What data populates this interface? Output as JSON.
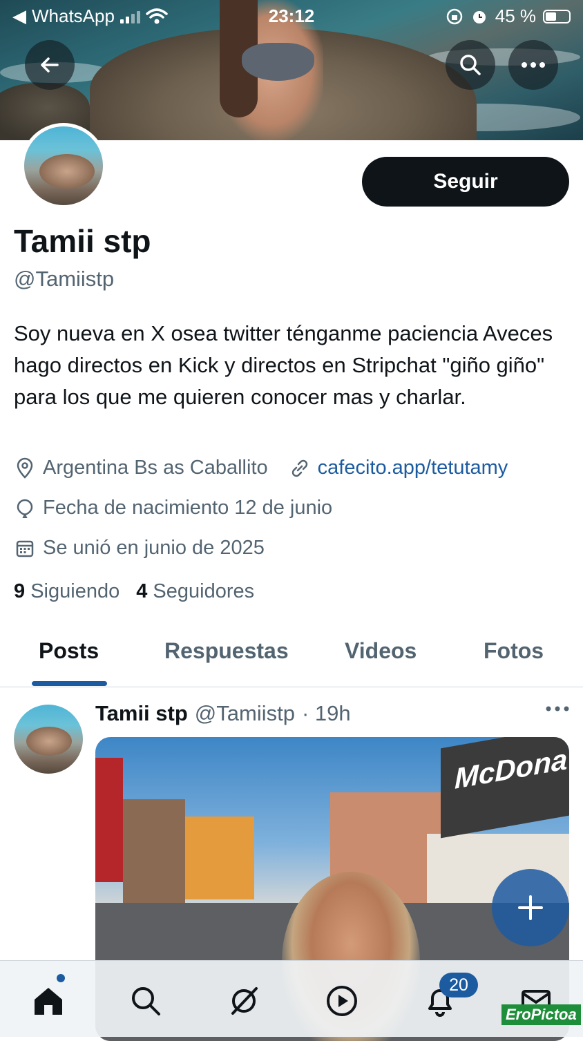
{
  "status_bar": {
    "back_app": "WhatsApp",
    "time": "23:12",
    "battery": "45 %"
  },
  "profile": {
    "follow_label": "Seguir",
    "name": "Tamii stp",
    "handle": "@Tamiistp",
    "bio": "Soy nueva en X osea twitter ténganme paciencia Aveces hago directos en Kick y directos en Stripchat \"giño giño\" para los que me quieren conocer mas y charlar.",
    "location": "Argentina Bs as Caballito",
    "website": "cafecito.app/tetutamy",
    "birthday": "Fecha de nacimiento 12 de junio",
    "joined": "Se unió en junio de 2025",
    "following_count": "9",
    "following_label": "Siguiendo",
    "followers_count": "4",
    "followers_label": "Seguidores"
  },
  "tabs": [
    {
      "label": "Posts",
      "active": true
    },
    {
      "label": "Respuestas",
      "active": false
    },
    {
      "label": "Videos",
      "active": false
    },
    {
      "label": "Fotos",
      "active": false
    }
  ],
  "post": {
    "author": "Tamii stp",
    "handle": "@Tamiistp",
    "time": "· 19h",
    "image_sign_text": "McDona"
  },
  "bottom_nav": {
    "notifications_badge": "20",
    "items": [
      "home-icon",
      "search-icon",
      "grok-icon",
      "video-icon",
      "notifications-icon",
      "messages-icon"
    ]
  },
  "watermark": "EroPictoa",
  "colors": {
    "accent": "#1d5ba0",
    "text_primary": "#0f1419",
    "text_secondary": "#536471",
    "follow_button": "#0f1419"
  }
}
